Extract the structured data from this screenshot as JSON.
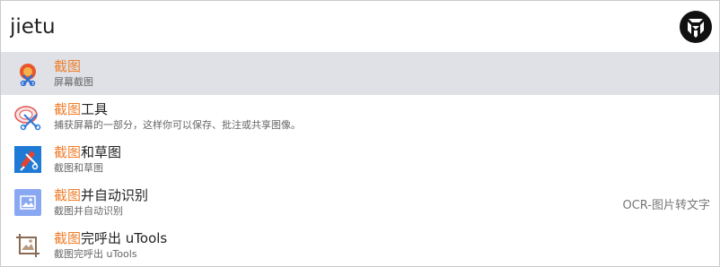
{
  "search": {
    "value": "jietu"
  },
  "results": [
    {
      "highlight": "截图",
      "rest": "",
      "subtitle": "屏幕截图",
      "right": "",
      "icon": "screenshot-app-icon"
    },
    {
      "highlight": "截图",
      "rest": "工具",
      "subtitle": "捕获屏幕的一部分，这样你可以保存、批注或共享图像。",
      "right": "",
      "icon": "snipping-tool-icon"
    },
    {
      "highlight": "截图",
      "rest": "和草图",
      "subtitle": "截图和草图",
      "right": "",
      "icon": "snip-sketch-icon"
    },
    {
      "highlight": "截图",
      "rest": "并自动识别",
      "subtitle": "截图并自动识别",
      "right": "OCR-图片转文字",
      "icon": "ocr-image-icon"
    },
    {
      "highlight": "截图",
      "rest": "完呼出 uTools",
      "subtitle": "截图完呼出 uTools",
      "right": "",
      "icon": "utools-screenshot-icon"
    }
  ],
  "colors": {
    "highlight": "#f07e2b",
    "selected_row": "#dfe1e6"
  }
}
